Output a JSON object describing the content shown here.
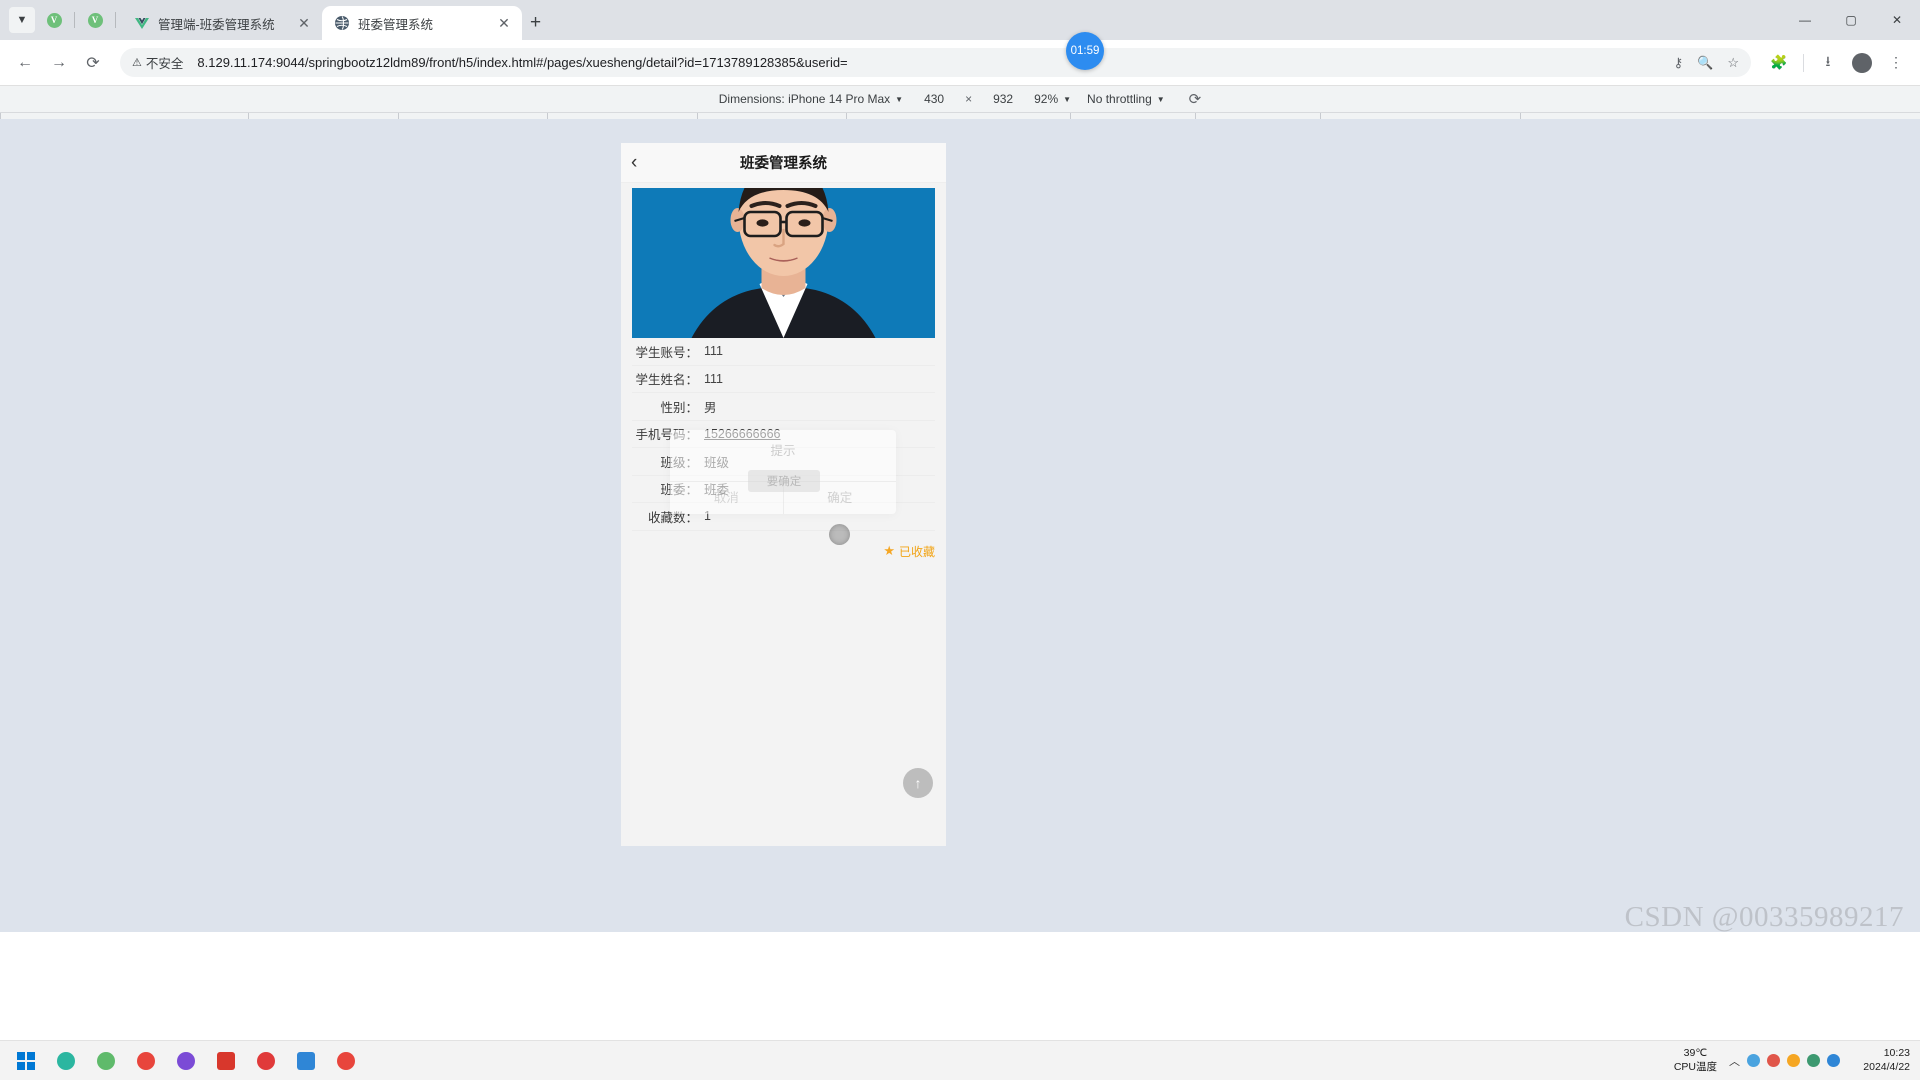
{
  "browser": {
    "tabs": [
      {
        "title": "管理端-班委管理系统",
        "favicon": "vue-icon",
        "active": false,
        "close_label": "✕"
      },
      {
        "title": "班委管理系统",
        "favicon": "globe-icon",
        "active": true,
        "close_label": "✕"
      }
    ],
    "newtab_label": "+",
    "tabstrip_left_icons": [
      "chevron-down-icon",
      "vue-icon",
      "vue-icon"
    ],
    "window_controls": {
      "minimize": "—",
      "maximize": "▢",
      "close": "✕"
    },
    "nav": {
      "back": "←",
      "forward": "→",
      "reload": "⟳"
    },
    "omnibox": {
      "security_label": "不安全",
      "security_icon": "warning-triangle-icon",
      "url": "8.129.11.174:9044/springbootz12ldm89/front/h5/index.html#/pages/xuesheng/detail?id=1713789128385&userid=",
      "right_icons": [
        "password-key-icon",
        "zoom-icon",
        "bookmark-star-icon"
      ]
    },
    "toolbar_icons": [
      "extensions-puzzle-icon",
      "download-icon",
      "profile-avatar-icon",
      "kebab-menu-icon"
    ],
    "profile_initial": "",
    "timer_badge": "01:59"
  },
  "devtools": {
    "dimensions_label": "Dimensions: iPhone 14 Pro Max",
    "dimensions_caret": "▼",
    "width": "430",
    "separator": "×",
    "height": "932",
    "zoom": "92%",
    "zoom_caret": "▼",
    "throttling": "No throttling",
    "throttling_caret": "▼",
    "rotate_icon": "rotate-device-icon"
  },
  "app": {
    "header": {
      "back_icon": "back-chevron-icon",
      "title": "班委管理系统"
    },
    "photo_alt": "student-id-photo",
    "fields": [
      {
        "label": "学生账号：",
        "value": "111",
        "type": "text"
      },
      {
        "label": "学生姓名：",
        "value": "111",
        "type": "text"
      },
      {
        "label": "性别：",
        "value": "男",
        "type": "text"
      },
      {
        "label": "手机号码：",
        "value": "15266666666",
        "type": "link"
      },
      {
        "label": "班级：",
        "value": "班级",
        "type": "text"
      },
      {
        "label": "班委：",
        "value": "班委",
        "type": "text"
      },
      {
        "label": "收藏数：",
        "value": "1",
        "type": "text"
      }
    ],
    "favorite": {
      "icon": "star-filled-icon",
      "label": "已收藏"
    },
    "modal": {
      "title": "提示",
      "cancel_label": "取消",
      "confirm_label": "确定",
      "confirm_chip_label": "要确定",
      "loading_icon": "spinner-icon"
    },
    "back_to_top_icon": "arrow-up-icon"
  },
  "watermark": "CSDN @00335989217",
  "taskbar": {
    "start_label": "start-button",
    "apps": [
      "edge-icon",
      "chrome-green-icon",
      "chrome-icon",
      "firefox-icon",
      "wps-icon",
      "music-icon",
      "folder-icon",
      "chrome-icon-2"
    ],
    "temperature": "39℃",
    "temperature_label": "CPU温度",
    "tray_icons": [
      "up-chevron-icon",
      "cloud-icon",
      "network-icon",
      "shield-icon",
      "volume-icon",
      "chat-icon"
    ],
    "time": "10:23",
    "date": "2024/4/22"
  }
}
